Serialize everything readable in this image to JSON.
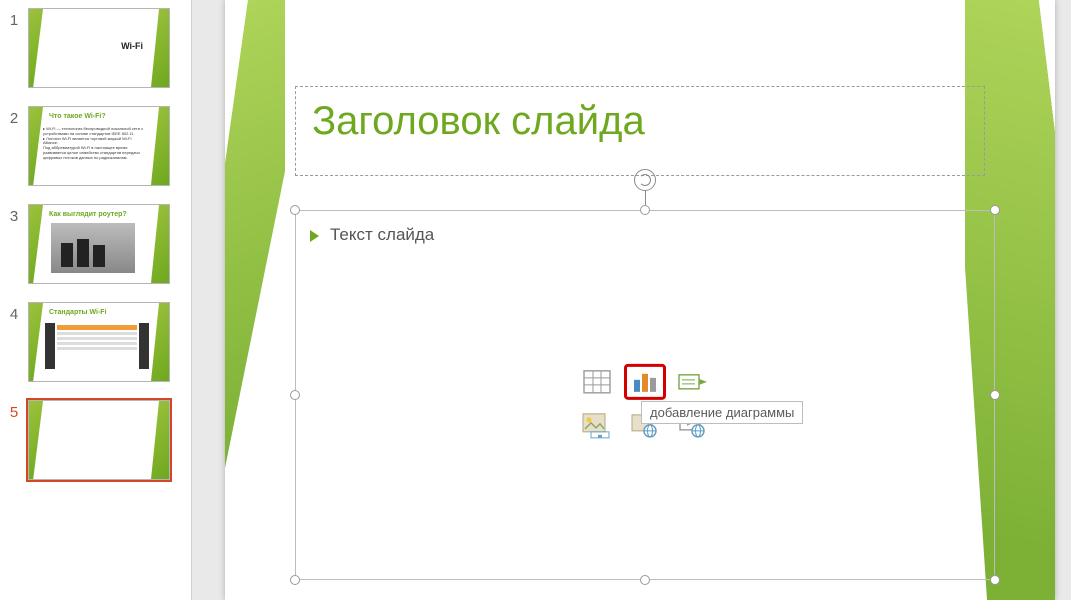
{
  "thumbnails": [
    {
      "num": "1",
      "title": "Wi-Fi",
      "subtitle": "",
      "type": "title"
    },
    {
      "num": "2",
      "title": "Что такое  Wi-Fi?",
      "type": "text"
    },
    {
      "num": "3",
      "title": "Как выглядит роутер?",
      "type": "image-dark"
    },
    {
      "num": "4",
      "title": "Стандарты  Wi-Fi",
      "type": "image-table"
    },
    {
      "num": "5",
      "title": "",
      "type": "blank",
      "selected": true
    }
  ],
  "slide": {
    "title_placeholder": "Заголовок слайда",
    "content_placeholder": "Текст слайда"
  },
  "insert_icons": {
    "table": "insert-table-icon",
    "chart": "insert-chart-icon",
    "smartart": "insert-smartart-icon",
    "pictures": "insert-pictures-icon",
    "online_pictures": "insert-online-pictures-icon",
    "video": "insert-video-icon"
  },
  "tooltip": "добавление диаграммы"
}
